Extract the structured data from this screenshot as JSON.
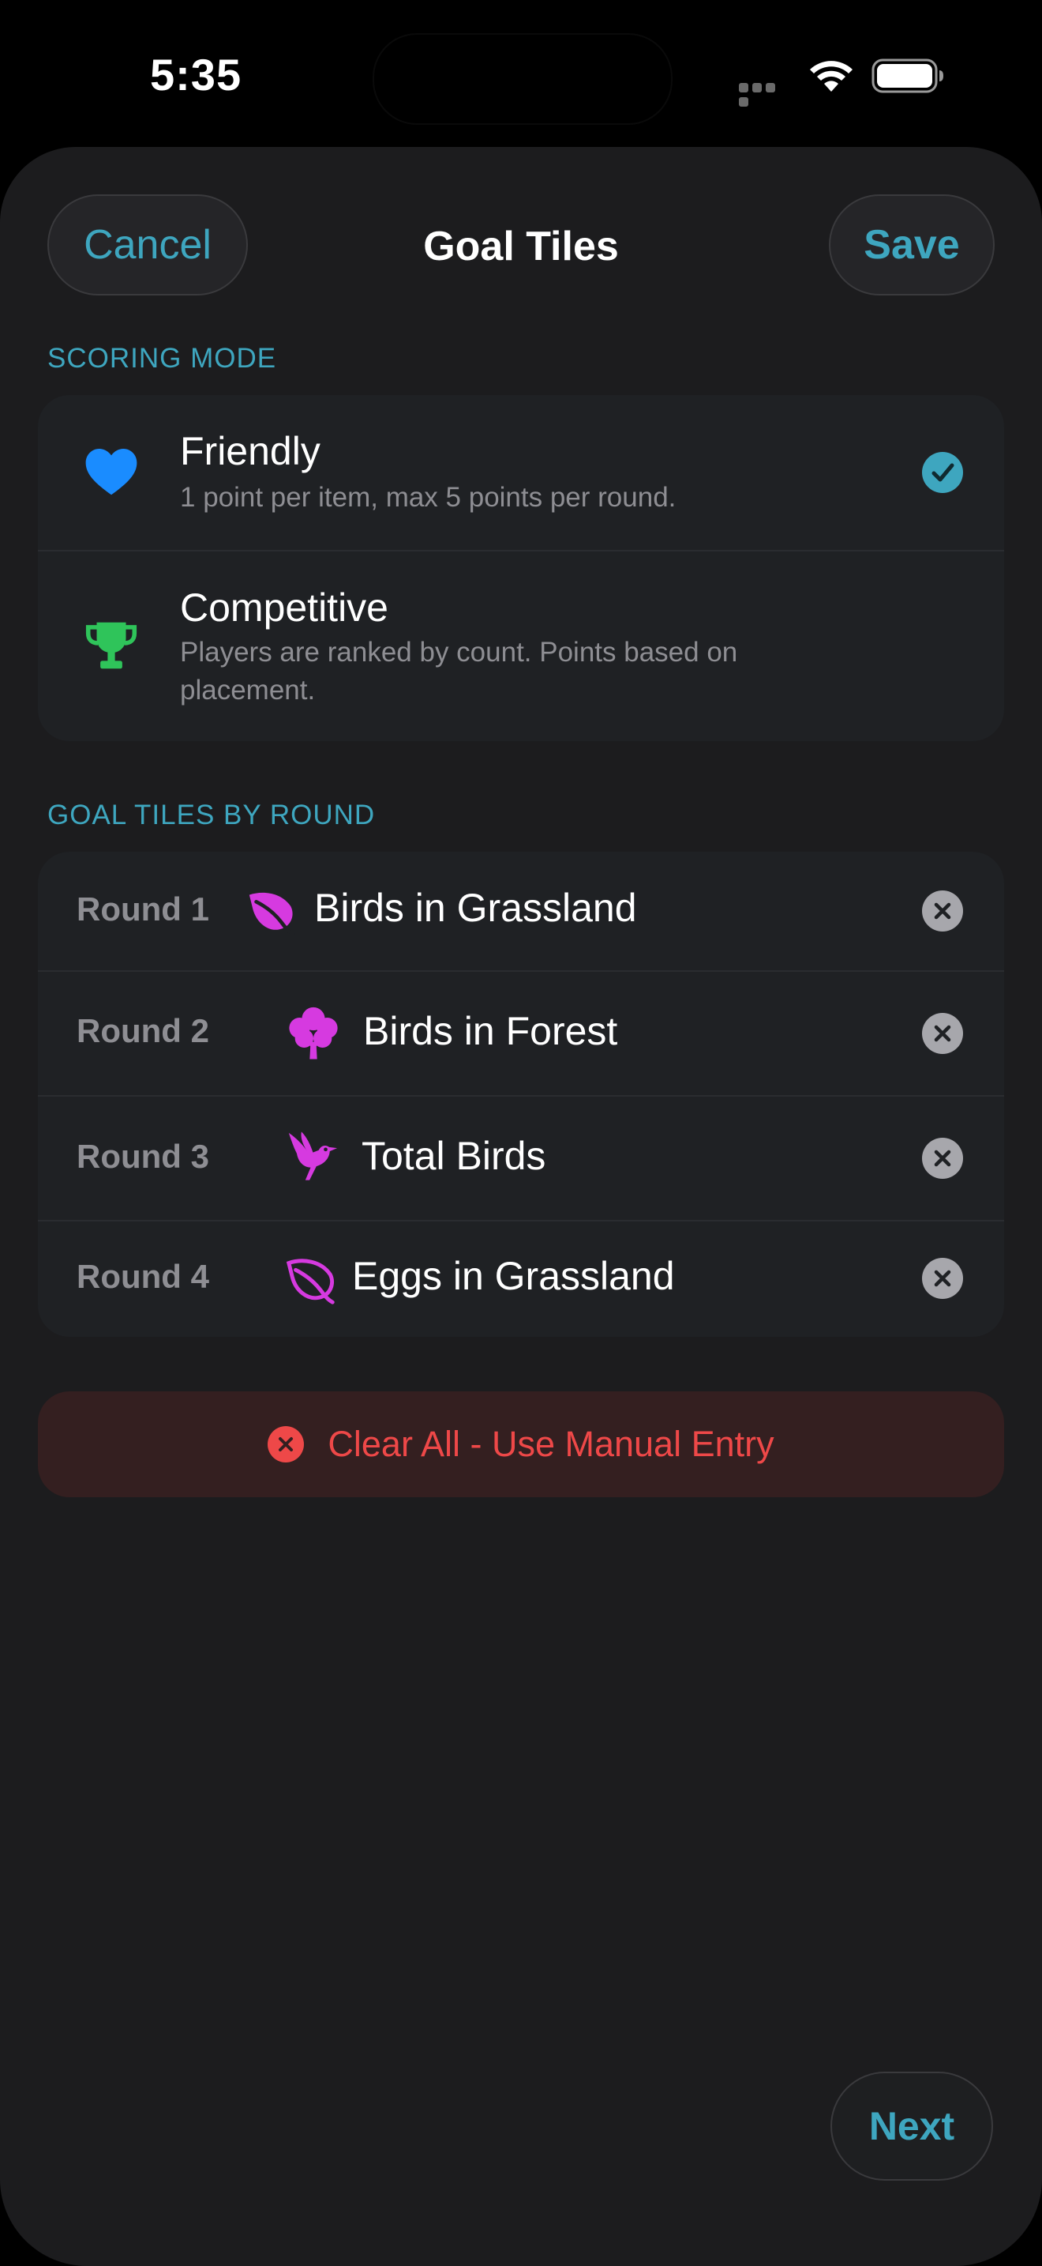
{
  "status_bar": {
    "time": "5:35"
  },
  "nav": {
    "cancel_label": "Cancel",
    "title": "Goal Tiles",
    "save_label": "Save"
  },
  "scoring_mode": {
    "header": "SCORING MODE",
    "options": [
      {
        "title": "Friendly",
        "description": "1 point per item, max 5 points per round.",
        "icon": "heart-icon",
        "selected": true
      },
      {
        "title": "Competitive",
        "description": "Players are ranked by count. Points based on placement.",
        "icon": "trophy-icon",
        "selected": false
      }
    ]
  },
  "goal_tiles": {
    "header": "GOAL TILES BY ROUND",
    "rounds": [
      {
        "round": "Round 1",
        "tile": "Birds in Grassland",
        "icon": "leaf-icon"
      },
      {
        "round": "Round 2",
        "tile": "Birds in Forest",
        "icon": "tree-icon"
      },
      {
        "round": "Round 3",
        "tile": "Total Birds",
        "icon": "bird-icon"
      },
      {
        "round": "Round 4",
        "tile": "Eggs in Grassland",
        "icon": "leaf-outline-icon"
      }
    ]
  },
  "clear_button": {
    "label": "Clear All - Use Manual Entry",
    "icon": "x-circle-icon"
  },
  "next_label": "Next",
  "colors": {
    "accent": "#3ea6bf",
    "tile_icon": "#d63ae0",
    "destructive": "#ee4848",
    "heart": "#1a8cff",
    "trophy": "#2fc45a"
  }
}
